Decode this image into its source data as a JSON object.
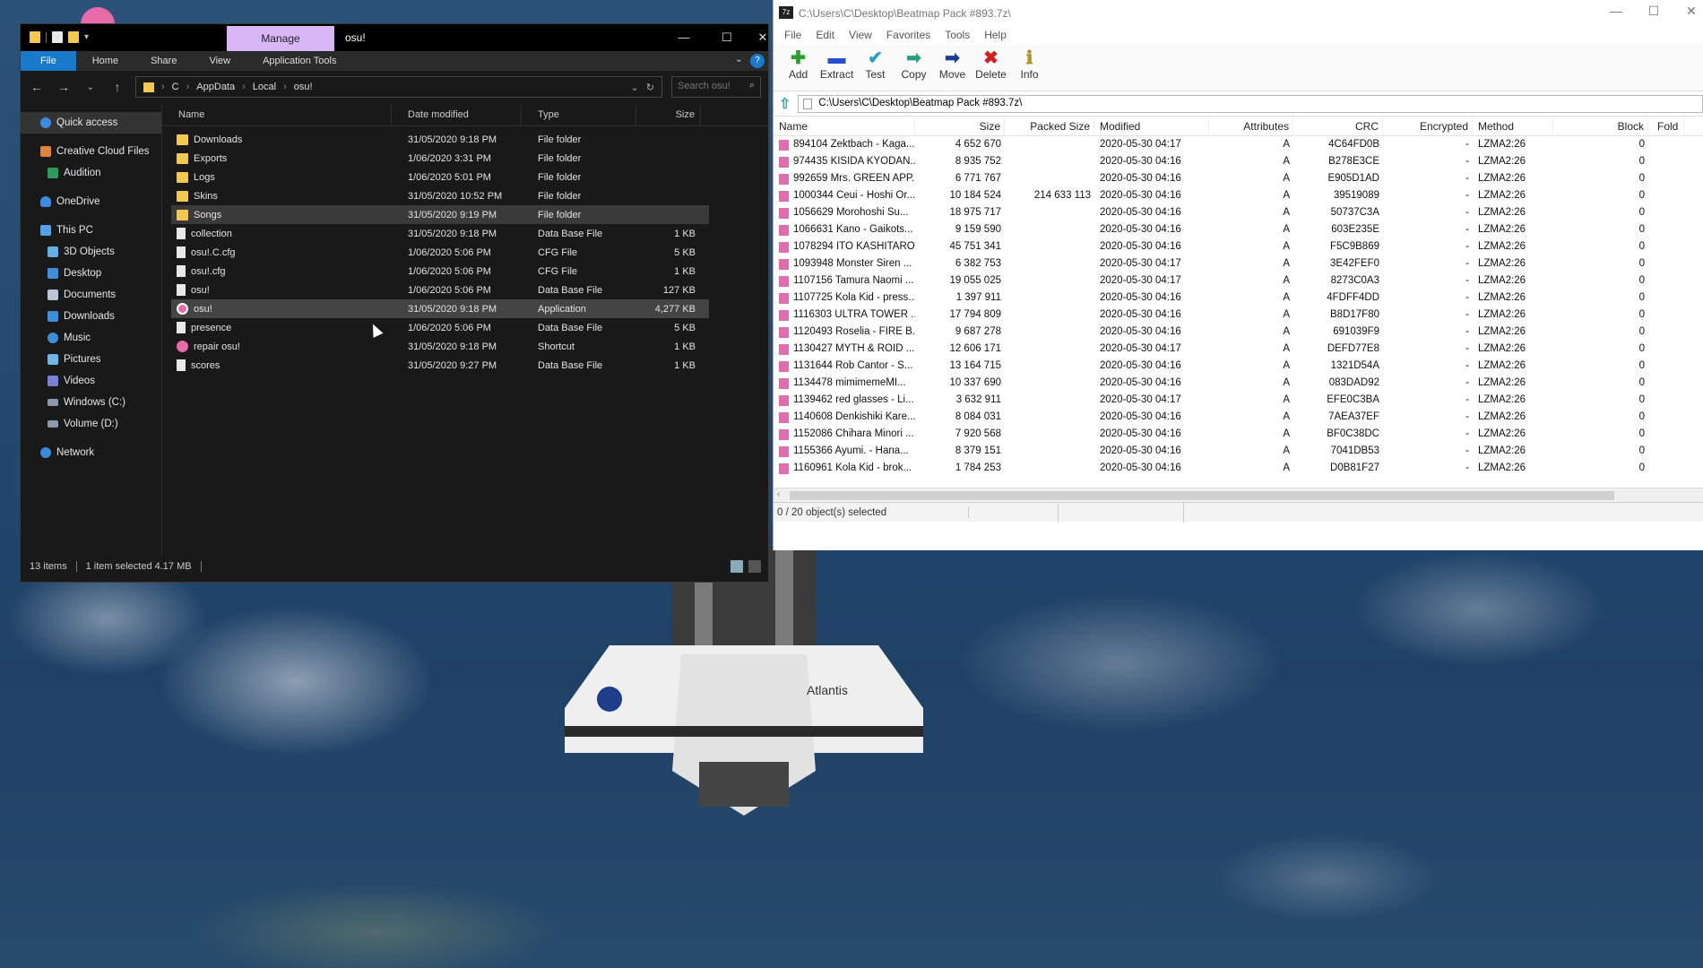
{
  "explorer": {
    "manage_tab": "Manage",
    "window_title": "osu!",
    "ribbon_tabs": [
      "File",
      "Home",
      "Share",
      "View",
      "Application Tools"
    ],
    "breadcrumb": [
      "C",
      "AppData",
      "Local",
      "osu!"
    ],
    "search_placeholder": "Search osu!",
    "nav": {
      "quick_access": "Quick access",
      "creative_cloud": "Creative Cloud Files",
      "audition": "Audition",
      "onedrive": "OneDrive",
      "this_pc": "This PC",
      "objects3d": "3D Objects",
      "desktop": "Desktop",
      "documents": "Documents",
      "downloads": "Downloads",
      "music": "Music",
      "pictures": "Pictures",
      "videos": "Videos",
      "windows_c": "Windows (C:)",
      "volume_d": "Volume (D:)",
      "network": "Network"
    },
    "columns": {
      "name": "Name",
      "date": "Date modified",
      "type": "Type",
      "size": "Size"
    },
    "files": [
      {
        "name": "Downloads",
        "date": "31/05/2020 9:18 PM",
        "type": "File folder",
        "size": "",
        "kind": "folder"
      },
      {
        "name": "Exports",
        "date": "1/06/2020 3:31 PM",
        "type": "File folder",
        "size": "",
        "kind": "folder"
      },
      {
        "name": "Logs",
        "date": "1/06/2020 5:01 PM",
        "type": "File folder",
        "size": "",
        "kind": "folder"
      },
      {
        "name": "Skins",
        "date": "31/05/2020 10:52 PM",
        "type": "File folder",
        "size": "",
        "kind": "folder"
      },
      {
        "name": "Songs",
        "date": "31/05/2020 9:19 PM",
        "type": "File folder",
        "size": "",
        "kind": "folder"
      },
      {
        "name": "collection",
        "date": "31/05/2020 9:18 PM",
        "type": "Data Base File",
        "size": "1 KB",
        "kind": "file"
      },
      {
        "name": "osu!.C.cfg",
        "date": "1/06/2020 5:06 PM",
        "type": "CFG File",
        "size": "5 KB",
        "kind": "file"
      },
      {
        "name": "osu!.cfg",
        "date": "1/06/2020 5:06 PM",
        "type": "CFG File",
        "size": "1 KB",
        "kind": "file"
      },
      {
        "name": "osu!",
        "date": "1/06/2020 5:06 PM",
        "type": "Data Base File",
        "size": "127 KB",
        "kind": "file"
      },
      {
        "name": "osu!",
        "date": "31/05/2020 9:18 PM",
        "type": "Application",
        "size": "4,277 KB",
        "kind": "app"
      },
      {
        "name": "presence",
        "date": "1/06/2020 5:06 PM",
        "type": "Data Base File",
        "size": "5 KB",
        "kind": "file"
      },
      {
        "name": "repair osu!",
        "date": "31/05/2020 9:18 PM",
        "type": "Shortcut",
        "size": "1 KB",
        "kind": "short"
      },
      {
        "name": "scores",
        "date": "31/05/2020 9:27 PM",
        "type": "Data Base File",
        "size": "1 KB",
        "kind": "file"
      }
    ],
    "status_items": "13 items",
    "status_selected": "1 item selected  4.17 MB"
  },
  "zip": {
    "title": "C:\\Users\\C\\Desktop\\Beatmap Pack #893.7z\\",
    "logo": "7z",
    "menu": [
      "File",
      "Edit",
      "View",
      "Favorites",
      "Tools",
      "Help"
    ],
    "toolbar": [
      {
        "label": "Add",
        "icon": "add-icon",
        "glyph": "✚",
        "color": "#2aa02a"
      },
      {
        "label": "Extract",
        "icon": "extract-icon",
        "glyph": "▬",
        "color": "#2a4ccf"
      },
      {
        "label": "Test",
        "icon": "test-icon",
        "glyph": "✔",
        "color": "#2aa0c0"
      },
      {
        "label": "Copy",
        "icon": "copy-icon",
        "glyph": "➡",
        "color": "#2aa080"
      },
      {
        "label": "Move",
        "icon": "move-icon",
        "glyph": "➡",
        "color": "#1a3aa0"
      },
      {
        "label": "Delete",
        "icon": "delete-icon",
        "glyph": "✖",
        "color": "#d02020"
      },
      {
        "label": "Info",
        "icon": "info-icon",
        "glyph": "ℹ",
        "color": "#b09020"
      }
    ],
    "path": "C:\\Users\\C\\Desktop\\Beatmap Pack #893.7z\\",
    "columns": [
      "Name",
      "Size",
      "Packed Size",
      "Modified",
      "Attributes",
      "CRC",
      "Encrypted",
      "Method",
      "Block",
      "Fold"
    ],
    "rows": [
      {
        "name": "894104 Zektbach - Kaga...",
        "size": "4 652 670",
        "packed": "",
        "modified": "2020-05-30 04:17",
        "attr": "A",
        "crc": "4C64FD0B",
        "enc": "-",
        "method": "LZMA2:26",
        "block": "0"
      },
      {
        "name": "974435 KISIDA KYODAN...",
        "size": "8 935 752",
        "packed": "",
        "modified": "2020-05-30 04:16",
        "attr": "A",
        "crc": "B278E3CE",
        "enc": "-",
        "method": "LZMA2:26",
        "block": "0"
      },
      {
        "name": "992659 Mrs. GREEN APP...",
        "size": "6 771 767",
        "packed": "",
        "modified": "2020-05-30 04:16",
        "attr": "A",
        "crc": "E905D1AD",
        "enc": "-",
        "method": "LZMA2:26",
        "block": "0"
      },
      {
        "name": "1000344 Ceui - Hoshi Or...",
        "size": "10 184 524",
        "packed": "214 633 113",
        "modified": "2020-05-30 04:16",
        "attr": "A",
        "crc": "39519089",
        "enc": "-",
        "method": "LZMA2:26",
        "block": "0"
      },
      {
        "name": "1056629 Morohoshi Su...",
        "size": "18 975 717",
        "packed": "",
        "modified": "2020-05-30 04:16",
        "attr": "A",
        "crc": "50737C3A",
        "enc": "-",
        "method": "LZMA2:26",
        "block": "0"
      },
      {
        "name": "1066631 Kano - Gaikots...",
        "size": "9 159 590",
        "packed": "",
        "modified": "2020-05-30 04:16",
        "attr": "A",
        "crc": "603E235E",
        "enc": "-",
        "method": "LZMA2:26",
        "block": "0"
      },
      {
        "name": "1078294 ITO KASHITARO...",
        "size": "45 751 341",
        "packed": "",
        "modified": "2020-05-30 04:16",
        "attr": "A",
        "crc": "F5C9B869",
        "enc": "-",
        "method": "LZMA2:26",
        "block": "0"
      },
      {
        "name": "1093948 Monster Siren ...",
        "size": "6 382 753",
        "packed": "",
        "modified": "2020-05-30 04:17",
        "attr": "A",
        "crc": "3E42FEF0",
        "enc": "-",
        "method": "LZMA2:26",
        "block": "0"
      },
      {
        "name": "1107156 Tamura Naomi ...",
        "size": "19 055 025",
        "packed": "",
        "modified": "2020-05-30 04:17",
        "attr": "A",
        "crc": "8273C0A3",
        "enc": "-",
        "method": "LZMA2:26",
        "block": "0"
      },
      {
        "name": "1107725 Kola Kid - press...",
        "size": "1 397 911",
        "packed": "",
        "modified": "2020-05-30 04:16",
        "attr": "A",
        "crc": "4FDFF4DD",
        "enc": "-",
        "method": "LZMA2:26",
        "block": "0"
      },
      {
        "name": "1116303 ULTRA TOWER ...",
        "size": "17 794 809",
        "packed": "",
        "modified": "2020-05-30 04:16",
        "attr": "A",
        "crc": "B8D17F80",
        "enc": "-",
        "method": "LZMA2:26",
        "block": "0"
      },
      {
        "name": "1120493 Roselia - FIRE B...",
        "size": "9 687 278",
        "packed": "",
        "modified": "2020-05-30 04:16",
        "attr": "A",
        "crc": "691039F9",
        "enc": "-",
        "method": "LZMA2:26",
        "block": "0"
      },
      {
        "name": "1130427 MYTH & ROID ...",
        "size": "12 606 171",
        "packed": "",
        "modified": "2020-05-30 04:17",
        "attr": "A",
        "crc": "DEFD77E8",
        "enc": "-",
        "method": "LZMA2:26",
        "block": "0"
      },
      {
        "name": "1131644 Rob Cantor - S...",
        "size": "13 164 715",
        "packed": "",
        "modified": "2020-05-30 04:16",
        "attr": "A",
        "crc": "1321D54A",
        "enc": "-",
        "method": "LZMA2:26",
        "block": "0"
      },
      {
        "name": "1134478 mimimemeMI...",
        "size": "10 337 690",
        "packed": "",
        "modified": "2020-05-30 04:16",
        "attr": "A",
        "crc": "083DAD92",
        "enc": "-",
        "method": "LZMA2:26",
        "block": "0"
      },
      {
        "name": "1139462 red glasses - Li...",
        "size": "3 632 911",
        "packed": "",
        "modified": "2020-05-30 04:17",
        "attr": "A",
        "crc": "EFE0C3BA",
        "enc": "-",
        "method": "LZMA2:26",
        "block": "0"
      },
      {
        "name": "1140608 Denkishiki Kare...",
        "size": "8 084 031",
        "packed": "",
        "modified": "2020-05-30 04:16",
        "attr": "A",
        "crc": "7AEA37EF",
        "enc": "-",
        "method": "LZMA2:26",
        "block": "0"
      },
      {
        "name": "1152086 Chihara Minori ...",
        "size": "7 920 568",
        "packed": "",
        "modified": "2020-05-30 04:16",
        "attr": "A",
        "crc": "BF0C38DC",
        "enc": "-",
        "method": "LZMA2:26",
        "block": "0"
      },
      {
        "name": "1155366 Ayumi. - Hana...",
        "size": "8 379 151",
        "packed": "",
        "modified": "2020-05-30 04:16",
        "attr": "A",
        "crc": "7041DB53",
        "enc": "-",
        "method": "LZMA2:26",
        "block": "0"
      },
      {
        "name": "1160961 Kola Kid - brok...",
        "size": "1 784 253",
        "packed": "",
        "modified": "2020-05-30 04:16",
        "attr": "A",
        "crc": "D0B81F27",
        "enc": "-",
        "method": "LZMA2:26",
        "block": "0"
      }
    ],
    "status": "0 / 20 object(s) selected"
  },
  "shuttle_label": "Atlantis"
}
